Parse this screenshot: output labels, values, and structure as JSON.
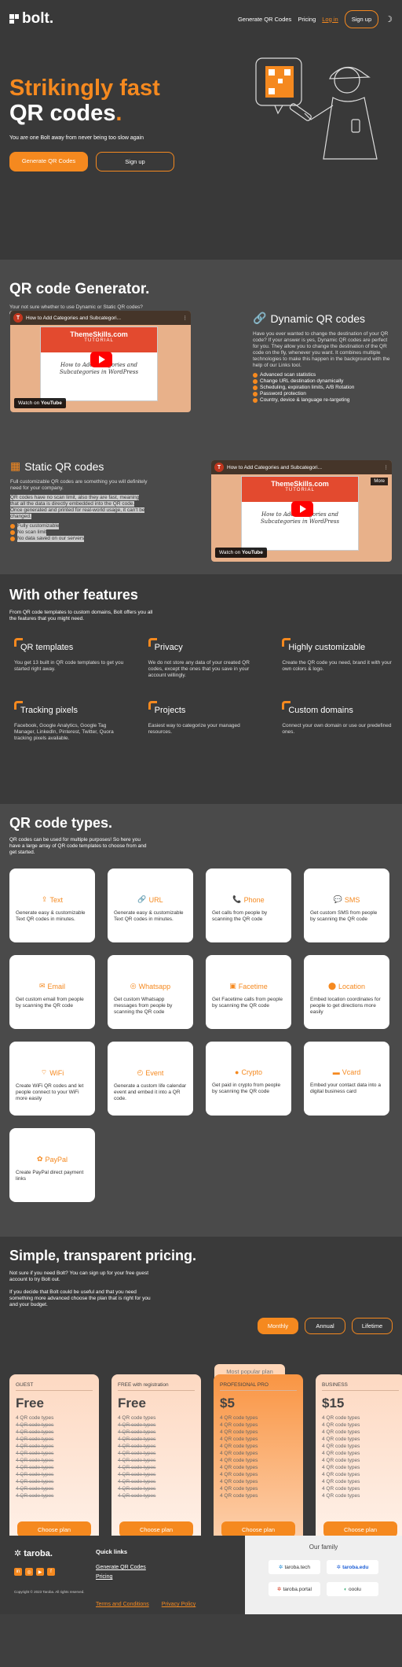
{
  "brand": {
    "name": "bolt.",
    "accent": "#f5891f"
  },
  "nav": {
    "generate": "Generate QR Codes",
    "pricing": "Pricing",
    "login": "Log in",
    "signup": "Sign up"
  },
  "hero": {
    "title_line1": "Strikingly fast",
    "title_line2": "QR codes",
    "title_dot": ".",
    "subtitle": "You are one Bolt away from never being too slow again",
    "btn_generate": "Generate QR Codes",
    "btn_signup": "Sign up"
  },
  "generator": {
    "title": "QR code Generator.",
    "lead": "Your not sure whether to use Dynamic or Static QR codes? Get familiar with both and choose wisely.",
    "video": {
      "title": "How to Add Categories and Subcategori...",
      "brand": "ThemeSkills.com",
      "tag": "TUTORIAL",
      "caption": "How to Add Categories and Subcategories in WordPress",
      "watch": "Watch on",
      "yt": "YouTube",
      "more": "More"
    },
    "dynamic": {
      "title": "Dynamic QR codes",
      "text": "Have you ever wanted to change the destination of your QR code? If your answer is yes, Dynamic QR codes are perfect for you. They allow you to change the destination of the QR code on the fly, whenever you want. It combines multiple technologies to make this happen in the background with the help of our Links tool.",
      "items": [
        "Advanced scan statistics",
        "Change URL destination dynamically",
        "Scheduling, expiration limits, A/B Rotation",
        "Password protection",
        "Country, device & language re-targeting"
      ]
    },
    "static": {
      "title": "Static QR codes",
      "text": "Full customizable QR codes are something you will definitely need for your company.",
      "highlight": "QR codes have no scan limit, also they are fast, meaning that all the data is directly embedded into the QR code. Once generated and printed for real-world usage, it can't be changed.",
      "items": [
        "Fully customizable",
        "No scan limit",
        "No data saved on our servers"
      ]
    }
  },
  "features": {
    "title": "With other features",
    "lead": "From QR code templates to custom domains, Bolt offers you all the features that you might need.",
    "items": [
      {
        "title": "QR templates",
        "text": "You get 13 built in QR code templates to get you started right away."
      },
      {
        "title": "Privacy",
        "text": "We do not store any data of your created QR codes, except the ones that you save in your account willingly."
      },
      {
        "title": "Highly customizable",
        "text": "Create the QR code you need, brand it with your own colors & logo."
      },
      {
        "title": "Tracking pixels",
        "text": "Facebook, Google Analytics, Google Tag Manager, LinkedIn, Pinterest, Twitter, Quora tracking pixels available."
      },
      {
        "title": "Projects",
        "text": "Easiest way to categorize your managed resources."
      },
      {
        "title": "Custom domains",
        "text": "Connect your own domain or use our predefined ones."
      }
    ]
  },
  "types": {
    "title": "QR code types.",
    "lead": "QR codes can be used for multiple purposes! So here you have a large array of QR code templates to choose from and get started.",
    "items": [
      {
        "icon": "text-icon",
        "glyph": "⇪",
        "title": "Text",
        "text": "Generate easy & customizable Text QR codes in minutes."
      },
      {
        "icon": "link-icon",
        "glyph": "🔗",
        "title": "URL",
        "text": "Generate easy & customizable Text QR codes in minutes."
      },
      {
        "icon": "phone-icon",
        "glyph": "📞",
        "title": "Phone",
        "text": "Get calls from people by scanning the QR code"
      },
      {
        "icon": "sms-icon",
        "glyph": "💬",
        "title": "SMS",
        "text": "Get custom SMS from people by scanning the QR code"
      },
      {
        "icon": "email-icon",
        "glyph": "✉",
        "title": "Email",
        "text": "Get custom email from people by scanning the QR code"
      },
      {
        "icon": "whatsapp-icon",
        "glyph": "◎",
        "title": "Whatsapp",
        "text": "Get custom Whatsapp messages from people by scanning the QR code"
      },
      {
        "icon": "facetime-icon",
        "glyph": "▣",
        "title": "Facetime",
        "text": "Get Facetime calls from people by scanning the QR code"
      },
      {
        "icon": "location-icon",
        "glyph": "⬤",
        "title": "Location",
        "text": "Embed location coordinates for people to get directions more easily"
      },
      {
        "icon": "wifi-icon",
        "glyph": "⌔",
        "title": "WiFi",
        "text": "Create WiFi QR codes and let people connect to your WiFi more easily"
      },
      {
        "icon": "event-icon",
        "glyph": "◴",
        "title": "Event",
        "text": "Generate a custom life calendar event and embed it into a QR code."
      },
      {
        "icon": "crypto-icon",
        "glyph": "●",
        "title": "Crypto",
        "text": "Get paid in crypto from people by scanning the QR code"
      },
      {
        "icon": "vcard-icon",
        "glyph": "▬",
        "title": "Vcard",
        "text": "Embed your contact data into a digital business card"
      },
      {
        "icon": "paypal-icon",
        "glyph": "✿",
        "title": "PayPal",
        "text": "Create PayPal direct payment links"
      }
    ]
  },
  "pricing": {
    "title": "Simple, transparent pricing.",
    "lead1": "Not sure if you need Bolt? You can sign up for your free guest account to try Bolt out.",
    "lead2": "If you decide that Bolt could be useful and that you need something more advanced choose the plan that is right for you and your budget.",
    "toggles": [
      "Monthly",
      "Annual",
      "Lifetime"
    ],
    "popular": "Most popular plan",
    "choose": "Choose plan",
    "plans": [
      {
        "name": "GUEST",
        "price": "Free",
        "features": [
          "4 QR code types",
          "4 QR code types",
          "4 QR code types",
          "4 QR code types",
          "4 QR code types",
          "4 QR code types",
          "4 QR code types",
          "4 QR code types",
          "4 QR code types",
          "4 QR code types",
          "4 QR code types",
          "4 QR code types"
        ]
      },
      {
        "name": "FREE with registration",
        "price": "Free",
        "features": [
          "4 QR code types",
          "4 QR code types",
          "4 QR code types",
          "4 QR code types",
          "4 QR code types",
          "4 QR code types",
          "4 QR code types",
          "4 QR code types",
          "4 QR code types",
          "4 QR code types",
          "4 QR code types",
          "4 QR code types"
        ]
      },
      {
        "name": "PROFESIONAL PRO",
        "price": "$5",
        "features": [
          "4 QR code types",
          "4 QR code types",
          "4 QR code types",
          "4 QR code types",
          "4 QR code types",
          "4 QR code types",
          "4 QR code types",
          "4 QR code types",
          "4 QR code types",
          "4 QR code types",
          "4 QR code types",
          "4 QR code types"
        ]
      },
      {
        "name": "BUSINESS",
        "price": "$15",
        "features": [
          "4 QR code types",
          "4 QR code types",
          "4 QR code types",
          "4 QR code types",
          "4 QR code types",
          "4 QR code types",
          "4 QR code types",
          "4 QR code types",
          "4 QR code types",
          "4 QR code types",
          "4 QR code types",
          "4 QR code types"
        ]
      }
    ]
  },
  "footer": {
    "brand": "taroba.",
    "copyright": "Copyright © 2023 Taroba. All rights reserved.",
    "quick_title": "Quick links",
    "quick": [
      "Generate QR Codes",
      "Pricing"
    ],
    "terms": "Terms and Conditions",
    "privacy": "Privacy Policy",
    "family_title": "Our family",
    "family": [
      "taroba.tech",
      "taroba.edu",
      "taroba.portal",
      "ooolu"
    ]
  }
}
